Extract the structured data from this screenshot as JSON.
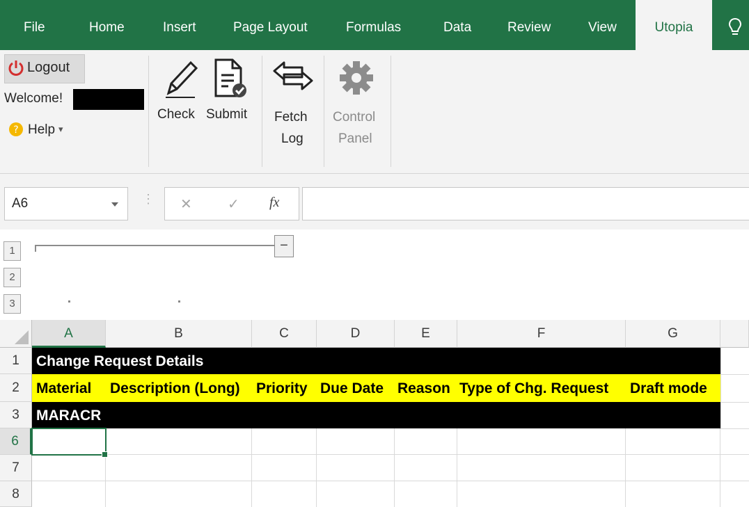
{
  "tabs": [
    "File",
    "Home",
    "Insert",
    "Page Layout",
    "Formulas",
    "Data",
    "Review",
    "View",
    "Utopia"
  ],
  "active_tab": "Utopia",
  "ribbon": {
    "logout_label": "Logout",
    "welcome_label": "Welcome!",
    "help_label": "Help",
    "help_caret": "▾",
    "check_label": "Check",
    "submit_label": "Submit",
    "fetch_label_1": "Fetch",
    "fetch_label_2": "Log",
    "control_label_1": "Control",
    "control_label_2": "Panel"
  },
  "formula_bar": {
    "name_box": "A6",
    "cancel_glyph": "✕",
    "enter_glyph": "✓",
    "fx_glyph": "fx",
    "formula": ""
  },
  "outline": {
    "levels": [
      "1",
      "2",
      "3"
    ],
    "collapse_glyph": "−"
  },
  "columns": [
    "A",
    "B",
    "C",
    "D",
    "E",
    "F",
    "G"
  ],
  "rows": [
    "1",
    "2",
    "3",
    "6",
    "7",
    "8"
  ],
  "cells": {
    "r1": "Change Request Details",
    "r2": [
      "Material",
      "Description (Long)",
      "Priority",
      "Due Date",
      "Reason",
      "Type of Chg. Request",
      "Draft mode"
    ],
    "r3": "MARACR"
  },
  "colors": {
    "ribbon_green": "#217346",
    "header_black": "#000000",
    "header_yellow": "#ffff00",
    "selection_green": "#217346"
  }
}
